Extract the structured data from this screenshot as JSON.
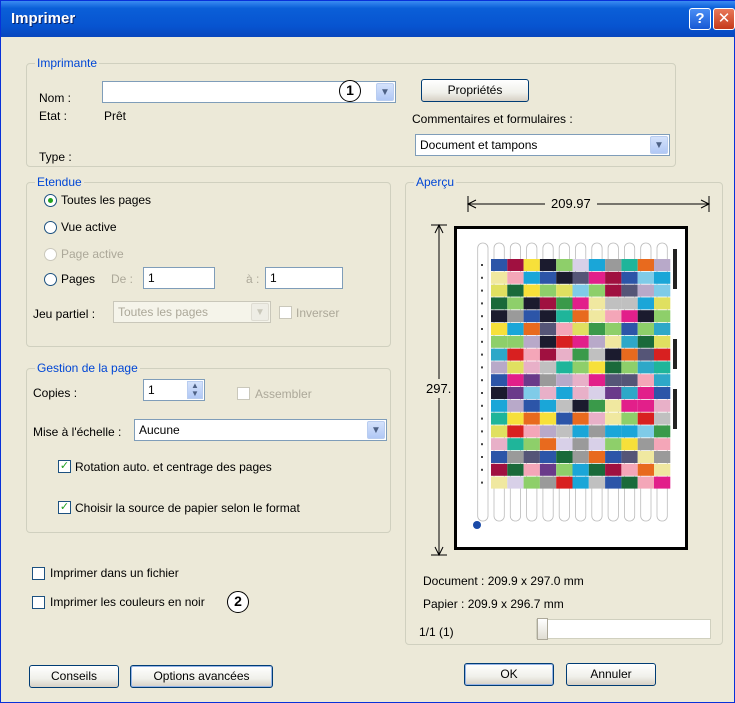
{
  "window": {
    "title": "Imprimer",
    "help_glyph": "?",
    "close_glyph": "✕"
  },
  "printer": {
    "group_label": "Imprimante",
    "name_label": "Nom :",
    "name_value": "",
    "status_label": "Etat :",
    "status_value": "Prêt",
    "type_label": "Type :",
    "properties_button": "Propriétés",
    "comments_label": "Commentaires et formulaires :",
    "comments_value": "Document et tampons"
  },
  "range": {
    "group_label": "Etendue",
    "all_pages": "Toutes les pages",
    "current_view": "Vue active",
    "current_page": "Page active",
    "pages_label": "Pages",
    "from_label": "De :",
    "from_value": "1",
    "to_label": "à :",
    "to_value": "1",
    "subset_label": "Jeu partiel :",
    "subset_value": "Toutes les pages",
    "reverse_label": "Inverser",
    "selected": "all_pages"
  },
  "page_handling": {
    "group_label": "Gestion de la page",
    "copies_label": "Copies :",
    "copies_value": "1",
    "collate_label": "Assembler",
    "scaling_label": "Mise à l'échelle :",
    "scaling_value": "Aucune",
    "auto_rotate_label": "Rotation auto. et centrage des pages",
    "auto_rotate_checked": true,
    "paper_source_label": "Choisir la source de papier selon le format",
    "paper_source_checked": true
  },
  "options": {
    "print_to_file": "Imprimer dans un fichier",
    "print_colors_black": "Imprimer les couleurs en noir"
  },
  "callouts": {
    "one": "1",
    "two": "2"
  },
  "preview": {
    "group_label": "Aperçu",
    "width": "209.97",
    "height": "297.",
    "document": "Document : 209.9 x 297.0 mm",
    "paper": "Papier : 209.9 x 296.7 mm",
    "page_indicator": "1/1 (1)",
    "slider_position": 0
  },
  "buttons": {
    "tips": "Conseils",
    "advanced": "Options avancées",
    "ok": "OK",
    "cancel": "Annuler"
  },
  "colors": {
    "title_bar": "#0754d0",
    "group_label": "#0046d5",
    "dialog_bg": "#ece9d8"
  }
}
